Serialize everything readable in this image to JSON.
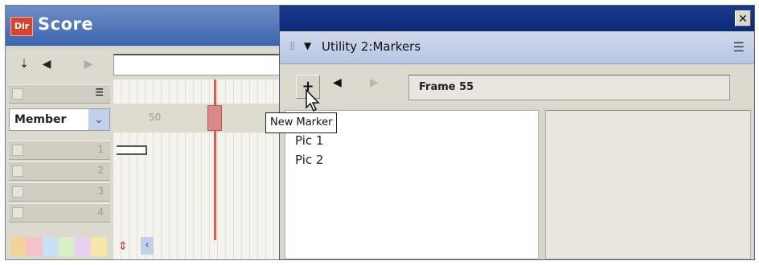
{
  "score": {
    "app_badge": "Dir",
    "title": "Score",
    "toolbar_icons": [
      "marker-menu-icon",
      "previous-marker-icon",
      "next-marker-icon"
    ],
    "member_select": "Member",
    "ruler_number": "50",
    "channel_numbers": [
      "1",
      "2",
      "3",
      "4"
    ],
    "colors": [
      "#f2d39a",
      "#f3c2cc",
      "#c9e1f5",
      "#d9efc6",
      "#e8d0f2",
      "#f6e7a7"
    ]
  },
  "markers": {
    "panel_title": "Utility 2:Markers",
    "close_glyph": "✕",
    "new_marker_glyph": "+",
    "frame_label": "Frame 55",
    "tooltip": "New Marker",
    "items": [
      "Pic 1",
      "Pic 2"
    ]
  }
}
